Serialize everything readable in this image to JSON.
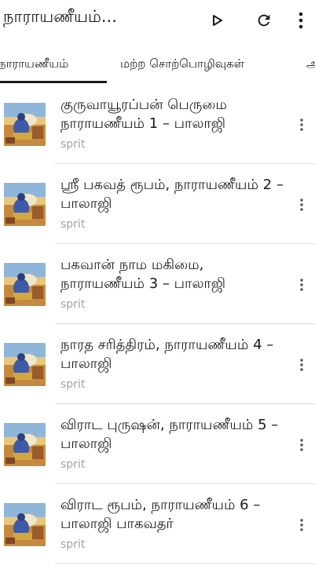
{
  "appbar": {
    "title": "நாராயணீயம்...",
    "play_icon": "play-icon",
    "refresh_icon": "refresh-icon",
    "more_icon": "more-vert-icon"
  },
  "tabs": [
    {
      "label": "நாராயணீயம்",
      "selected": true
    },
    {
      "label": "மற்ற சொற்பொழிவுகள்",
      "selected": false
    },
    {
      "label": "அ",
      "selected": false
    }
  ],
  "episodes": [
    {
      "title": "குருவாயூரப்பன் பெருமை நாராயணீயம் 1 – பாலாஜி",
      "author": "sprit"
    },
    {
      "title": "ஸ்ரீ பகவத் ரூபம், நாராயணீயம் 2 – பாலாஜி",
      "author": "sprit"
    },
    {
      "title": "பகவான் நாம மகிமை, நாராயணீயம் 3 – பாலாஜி",
      "author": "sprit"
    },
    {
      "title": "நாரத சரித்திரம், நாராயணீயம் 4 – பாலாஜி",
      "author": "sprit"
    },
    {
      "title": "விராட புருஷன், நாராயணீயம் 5 – பாலாஜி",
      "author": "sprit"
    },
    {
      "title": "விராட ரூபம், நாராயணீயம் 6 – பாலாஜி பாகவதர்",
      "author": "sprit"
    }
  ],
  "colors": {
    "accent": "#1a1a1a",
    "subtitle": "#a0a0a0",
    "divider": "#dcdcdc"
  }
}
